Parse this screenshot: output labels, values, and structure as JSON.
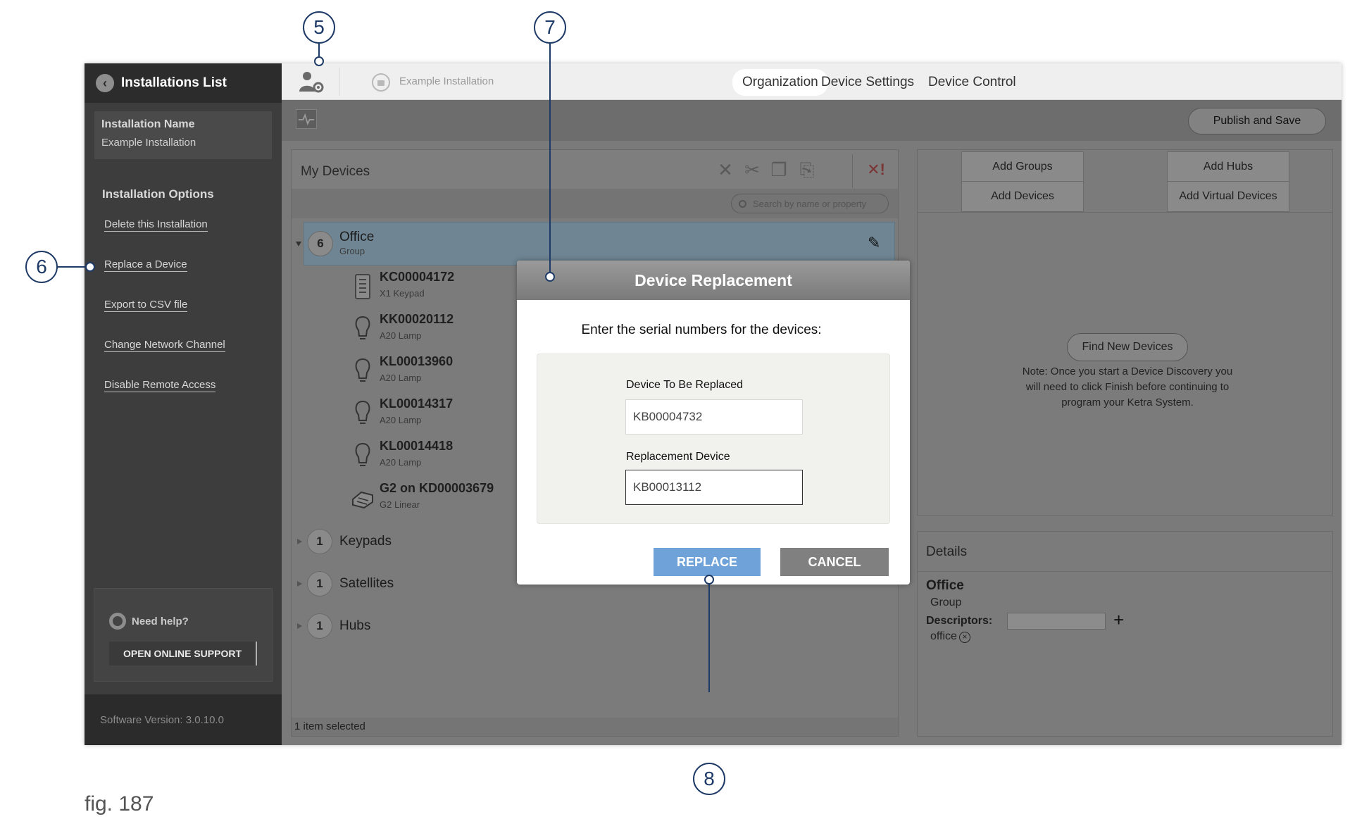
{
  "sidebar": {
    "back_label": "Installations List",
    "installation_name_label": "Installation Name",
    "installation_name_value": "Example Installation",
    "options_title": "Installation Options",
    "options": [
      {
        "label": "Delete this Installation"
      },
      {
        "label": "Replace a Device"
      },
      {
        "label": "Export to CSV file"
      },
      {
        "label": "Change Network Channel"
      },
      {
        "label": "Disable Remote Access"
      }
    ],
    "help_label": "Need help?",
    "support_button": "OPEN ONLINE SUPPORT",
    "version": "Software Version: 3.0.10.0"
  },
  "topbar": {
    "installation_name": "Example Installation",
    "tabs": [
      {
        "label": "Organization",
        "active": true
      },
      {
        "label": "Device Settings",
        "active": false
      },
      {
        "label": "Device Control",
        "active": false
      }
    ],
    "publish_button": "Publish and Save"
  },
  "my_devices": {
    "title": "My Devices",
    "search_placeholder": "Search by name or property",
    "groups": [
      {
        "count": "6",
        "name": "Office",
        "sub": "Group"
      },
      {
        "count": "1",
        "name": "Keypads"
      },
      {
        "count": "1",
        "name": "Satellites"
      },
      {
        "count": "1",
        "name": "Hubs"
      }
    ],
    "devices": [
      {
        "serial": "KC00004172",
        "type": "X1 Keypad",
        "icon": "keypad-icon"
      },
      {
        "serial": "KK00020112",
        "type": "A20 Lamp",
        "icon": "lamp-icon"
      },
      {
        "serial": "KL00013960",
        "type": "A20 Lamp",
        "icon": "lamp-icon"
      },
      {
        "serial": "KL00014317",
        "type": "A20 Lamp",
        "icon": "lamp-icon"
      },
      {
        "serial": "KL00014418",
        "type": "A20 Lamp",
        "icon": "lamp-icon"
      },
      {
        "serial": "G2 on KD00003679",
        "type": "G2 Linear",
        "icon": "linear-fixture-icon"
      }
    ],
    "status": "1 item selected"
  },
  "add_panel": {
    "add_groups": "Add Groups",
    "add_devices": "Add Devices",
    "add_hubs": "Add Hubs",
    "add_virtual": "Add Virtual Devices",
    "find_button": "Find New Devices",
    "note": "Note: Once you start a Device Discovery you will need to click Finish before continuing to program your Ketra System."
  },
  "details": {
    "title": "Details",
    "name": "Office",
    "sub": "Group",
    "descriptors_label": "Descriptors:",
    "tag": "office"
  },
  "modal": {
    "title": "Device Replacement",
    "instruction": "Enter the serial numbers for the devices:",
    "field1_label": "Device To Be Replaced",
    "field1_value": "KB00004732",
    "field2_label": "Replacement Device",
    "field2_value": "KB00013112",
    "replace_button": "REPLACE",
    "cancel_button": "CANCEL"
  },
  "callouts": {
    "c5": "5",
    "c6": "6",
    "c7": "7",
    "c8": "8"
  },
  "figure_caption": "fig. 187",
  "colors": {
    "callout": "#1e3a66",
    "replace_button": "#6ea2d8",
    "selected_group": "#6f8593"
  }
}
